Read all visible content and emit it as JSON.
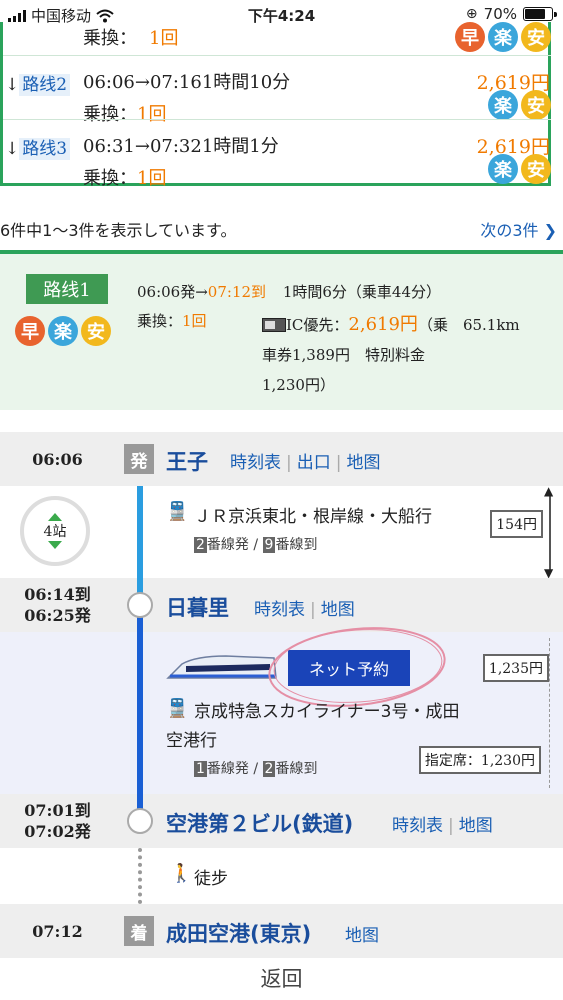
{
  "status": {
    "carrier": "中国移动",
    "time": "下午4:24",
    "battery": "70%",
    "battery_level": 0.7
  },
  "route_list": {
    "partial_transfer": "乗換：",
    "partial_transfer_count": "1回",
    "routes": [
      {
        "label": "路线2",
        "times": "06:06→07:161時間10分",
        "fare": "2,619円",
        "transfer_label": "乗換：",
        "transfer_count": "1回",
        "badges": [
          "楽",
          "安"
        ]
      },
      {
        "label": "路线3",
        "times": "06:31→07:321時間1分",
        "fare": "2,619円",
        "transfer_label": "乗換：",
        "transfer_count": "1回",
        "badges": [
          "楽",
          "安"
        ]
      }
    ],
    "first_badges": [
      "早",
      "楽",
      "安"
    ]
  },
  "pager": {
    "count_text": "6件中1〜3件を表示しています。",
    "next_label": "次の3件"
  },
  "summary": {
    "route_label": "路线1",
    "badges": [
      "早",
      "楽",
      "安"
    ],
    "depart": "06:06発→",
    "arrive": "07:12到",
    "duration": "1時間6分（乗車44分）",
    "transfer_label": "乗換：",
    "transfer_count": "1回",
    "ic_label": "IC優先：",
    "ic_fare": "2,619円",
    "ic_rest_1": "（乗　65.1km",
    "ic_rest_2": "車券1,389円　特別料金",
    "ic_rest_3": "1,230円）"
  },
  "timeline": {
    "stations": [
      {
        "time": "06:06",
        "mark": "発",
        "name": "王子",
        "links": [
          "時刻表",
          "出口",
          "地图"
        ]
      },
      {
        "time_arr": "06:14到",
        "time_dep": "06:25発",
        "name": "日暮里",
        "links": [
          "時刻表",
          "地图"
        ]
      },
      {
        "time_arr": "07:01到",
        "time_dep": "07:02発",
        "name": "空港第２ビル(鉄道)",
        "links": [
          "時刻表",
          "地图"
        ]
      },
      {
        "time": "07:12",
        "mark": "着",
        "name": "成田空港(東京)",
        "links": [
          "地图"
        ]
      }
    ],
    "seg1": {
      "stops": "4站",
      "train": "ＪＲ京浜東北・根岸線・大船行",
      "dep_track": "2",
      "dep_text": "番線発 /",
      "arr_track": "9",
      "arr_text": "番線到",
      "fare": "154円"
    },
    "seg2": {
      "reserve": "ネット予約",
      "train_1": "京成特急スカイライナー3号・成田",
      "train_2": "空港行",
      "dep_track": "1",
      "dep_text": "番線発 /",
      "arr_track": "2",
      "arr_text": "番線到",
      "fare": "1,235円",
      "reserved_seat": "指定席：1,230円"
    },
    "walk": "徒步"
  },
  "back_label": "返回"
}
